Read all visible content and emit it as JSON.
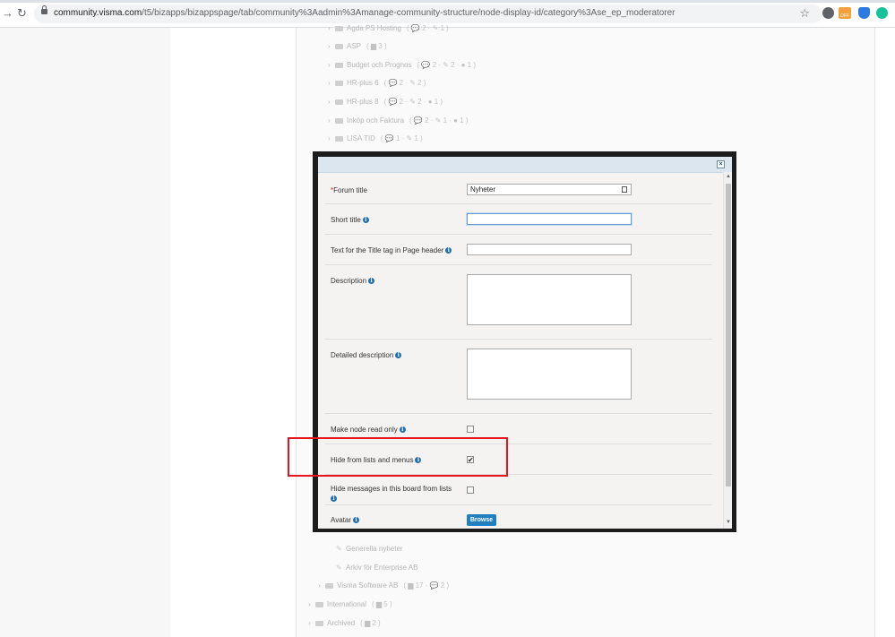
{
  "browser": {
    "url_host": "community.visma.com",
    "url_path": "/t5/bizapps/bizappspage/tab/community%3Aadmin%3Amanage-community-structure/node-display-id/category%3Ase_ep_moderatorer",
    "extension_badge": "OFF"
  },
  "tree_above": [
    {
      "label": "Agda PS Hosting",
      "meta": "( 💬 2 · ✎ 1 )"
    },
    {
      "label": "ASP",
      "meta": "( ▆ 3 )"
    },
    {
      "label": "Budget och Prognos",
      "meta": "( 💬 2 · ✎ 2 · ● 1 )"
    },
    {
      "label": "HR-plus 6",
      "meta": "( 💬 2 · ✎ 2 )"
    },
    {
      "label": "HR-plus 8",
      "meta": "( 💬 2 · ✎ 2 · ● 1 )"
    },
    {
      "label": "Inköp och Faktura",
      "meta": "( 💬 2 · ✎ 1 · ● 1 )"
    },
    {
      "label": "LISA TID",
      "meta": "( 💬 1 · ✎ 1 )"
    }
  ],
  "tree_below": [
    {
      "label": "Generella nyheter",
      "meta": ""
    },
    {
      "label": "Arkiv för Enterprise AB",
      "meta": ""
    },
    {
      "label": "Visma Software AB",
      "meta": "( ▆ 17 · 💬 2 )"
    },
    {
      "label": "International",
      "meta": "( ▆ 5 )"
    },
    {
      "label": "Archived",
      "meta": "( ▆ 2 )"
    }
  ],
  "modal": {
    "close_symbol": "×",
    "fields": {
      "forum_title": {
        "required_mark": "*",
        "label": "Forum title",
        "value": "Nyheter"
      },
      "short_title": {
        "label": "Short title",
        "value": ""
      },
      "title_tag": {
        "label": "Text for the Title tag in Page header",
        "value": ""
      },
      "description": {
        "label": "Description"
      },
      "detailed_description": {
        "label": "Detailed description"
      },
      "read_only": {
        "label": "Make node read only",
        "checked": false
      },
      "hide_lists": {
        "label": "Hide from lists and menus",
        "checked": true
      },
      "hide_messages": {
        "label": "Hide messages in this board from lists",
        "checked": false
      },
      "avatar": {
        "label": "Avatar",
        "button": "Browse"
      }
    }
  },
  "glyphs": {
    "info": "i",
    "check": "✔",
    "chevron": "›",
    "scroll_up": "▲",
    "scroll_down": "▼"
  },
  "colors": {
    "highlight": "#e8141b",
    "modal_frame": "#1c1c1c",
    "browse": "#1f7fc1",
    "info": "#1f6fb2"
  }
}
